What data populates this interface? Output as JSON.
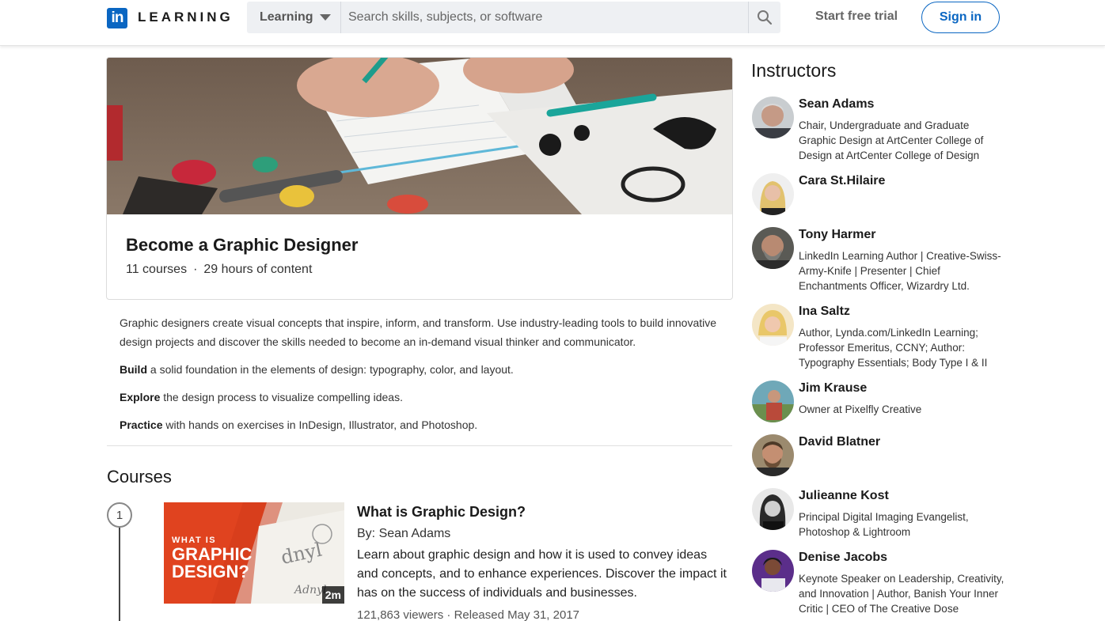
{
  "header": {
    "logo_mark": "in",
    "logo_word": "LEARNING",
    "search_scope": "Learning",
    "search_placeholder": "Search skills, subjects, or software",
    "start_trial": "Start free trial",
    "sign_in": "Sign in",
    "brand_color": "#0a66c2"
  },
  "path": {
    "title": "Become a Graphic Designer",
    "courses_count": "11 courses",
    "separator": "·",
    "content_hours": "29 hours of content",
    "description": "Graphic designers create visual concepts that inspire, inform, and transform. Use industry-leading tools to build innovative design projects and discover the skills needed to become an in-demand visual thinker and communicator.",
    "points": [
      {
        "bold": "Build",
        "text": " a solid foundation in the elements of design: typography, color, and layout."
      },
      {
        "bold": "Explore",
        "text": " the design process to visualize compelling ideas."
      },
      {
        "bold": "Practice",
        "text": " with hands on exercises in InDesign, Illustrator, and Photoshop."
      }
    ]
  },
  "courses": {
    "heading": "Courses",
    "items": [
      {
        "step": "1",
        "thumb_text_1": "WHAT IS",
        "thumb_text_2": "GRAPHIC",
        "thumb_text_3": "DESIGN?",
        "duration": "2m",
        "title": "What is Graphic Design?",
        "by": "By: Sean Adams",
        "description": "Learn about graphic design and how it is used to convey ideas and concepts, and to enhance experiences. Discover the impact it has on the success of individuals and businesses.",
        "stats": "121,863 viewers · Released May 31, 2017"
      }
    ]
  },
  "instructors": {
    "heading": "Instructors",
    "items": [
      {
        "name": "Sean Adams",
        "headline": "Chair, Undergraduate and Graduate Graphic Design at ArtCenter College of Design at ArtCenter College of Design"
      },
      {
        "name": "Cara St.Hilaire",
        "headline": ""
      },
      {
        "name": "Tony Harmer",
        "headline": "LinkedIn Learning Author | Creative-Swiss-Army-Knife | Presenter | Chief Enchantments Officer, Wizardry Ltd."
      },
      {
        "name": "Ina Saltz",
        "headline": "Author, Lynda.com/LinkedIn Learning; Professor Emeritus, CCNY; Author: Typography Essentials; Body Type I & II"
      },
      {
        "name": "Jim Krause",
        "headline": "Owner at Pixelfly Creative"
      },
      {
        "name": "David Blatner",
        "headline": ""
      },
      {
        "name": "Julieanne Kost",
        "headline": "Principal Digital Imaging Evangelist, Photoshop & Lightroom"
      },
      {
        "name": "Denise Jacobs",
        "headline": "Keynote Speaker on Leadership, Creativity, and Innovation | Author, Banish Your Inner Critic | CEO of The Creative Dose"
      }
    ]
  }
}
